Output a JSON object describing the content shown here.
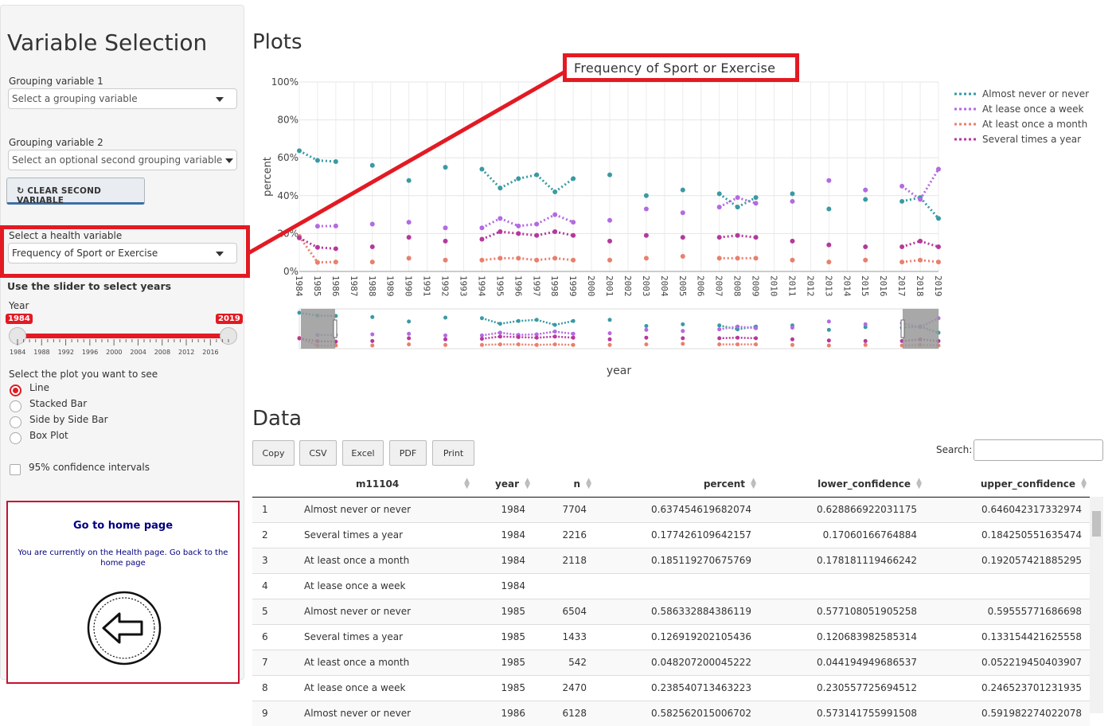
{
  "sidebar": {
    "title": "Variable Selection",
    "group1_label": "Grouping variable 1",
    "group1_placeholder": "Select a grouping variable",
    "group2_label": "Grouping variable 2",
    "group2_placeholder": "Select an optional second grouping variable",
    "clear_button": "CLEAR SECOND VARIABLE",
    "health_label": "Select a health variable",
    "health_value": "Frequency of Sport or Exercise",
    "slider_heading": "Use the slider to select years",
    "slider_label": "Year",
    "slider_min": "1984",
    "slider_max": "2019",
    "slider_ticks": [
      "1984",
      "1988",
      "1992",
      "1996",
      "2000",
      "2004",
      "2008",
      "2012",
      "2016"
    ],
    "plot_type_label": "Select the plot you want to see",
    "plot_types": [
      "Line",
      "Stacked Bar",
      "Side by Side Bar",
      "Box Plot"
    ],
    "plot_type_selected": "Line",
    "ci_label": "95% confidence intervals",
    "home_title": "Go to home page",
    "home_text": "You are currently on the Health page. Go back to the home page"
  },
  "main": {
    "plots_heading": "Plots",
    "data_heading": "Data",
    "buttons": [
      "Copy",
      "CSV",
      "Excel",
      "PDF",
      "Print"
    ],
    "search_label": "Search:"
  },
  "annotation": {
    "callout_text": "Frequency of Sport or Exercise"
  },
  "colors": {
    "accent": "#e31a23",
    "teal": "#3a9aa3",
    "purple": "#b36ae2",
    "salmon": "#e8806e",
    "magenta": "#b5399b"
  },
  "chart_data": {
    "type": "line",
    "xlabel": "year",
    "ylabel": "percent",
    "ylim": [
      0,
      1
    ],
    "yticks": [
      "0%",
      "20%",
      "40%",
      "60%",
      "80%",
      "100%"
    ],
    "x": [
      1984,
      1985,
      1986,
      1987,
      1988,
      1989,
      1990,
      1991,
      1992,
      1993,
      1994,
      1995,
      1996,
      1997,
      1998,
      1999,
      2000,
      2001,
      2002,
      2003,
      2004,
      2005,
      2006,
      2007,
      2008,
      2009,
      2010,
      2011,
      2012,
      2013,
      2014,
      2015,
      2016,
      2017,
      2018,
      2019
    ],
    "legend_position": "top-right",
    "series": [
      {
        "name": "Almost never or never",
        "color": "#3a9aa3",
        "values": [
          0.637,
          0.586,
          0.58,
          null,
          0.56,
          null,
          0.48,
          null,
          0.55,
          null,
          0.54,
          0.44,
          0.49,
          0.51,
          0.42,
          0.49,
          null,
          0.51,
          null,
          0.4,
          null,
          0.43,
          null,
          0.41,
          0.34,
          0.39,
          null,
          0.41,
          null,
          0.33,
          null,
          0.38,
          null,
          0.37,
          0.39,
          0.28
        ]
      },
      {
        "name": "At lease once a week",
        "color": "#b36ae2",
        "values": [
          null,
          0.239,
          0.24,
          null,
          0.25,
          null,
          0.26,
          null,
          0.23,
          null,
          0.23,
          0.28,
          0.24,
          0.25,
          0.3,
          0.26,
          null,
          0.27,
          null,
          0.33,
          null,
          0.31,
          null,
          0.34,
          0.39,
          0.36,
          null,
          0.37,
          null,
          0.48,
          null,
          0.43,
          null,
          0.45,
          0.38,
          0.54
        ]
      },
      {
        "name": "At least once a month",
        "color": "#e8806e",
        "values": [
          0.185,
          0.048,
          0.05,
          null,
          0.05,
          null,
          0.07,
          null,
          0.06,
          null,
          0.06,
          0.07,
          0.07,
          0.06,
          0.07,
          0.06,
          null,
          0.06,
          null,
          0.07,
          null,
          0.08,
          null,
          0.07,
          0.07,
          0.07,
          null,
          0.06,
          null,
          0.05,
          null,
          0.06,
          null,
          0.05,
          0.06,
          0.05
        ]
      },
      {
        "name": "Several times a year",
        "color": "#b5399b",
        "values": [
          0.177,
          0.127,
          0.12,
          null,
          0.13,
          null,
          0.18,
          null,
          0.16,
          null,
          0.17,
          0.21,
          0.2,
          0.19,
          0.21,
          0.19,
          null,
          0.16,
          null,
          0.19,
          null,
          0.18,
          null,
          0.18,
          0.19,
          0.18,
          null,
          0.16,
          null,
          0.14,
          null,
          0.13,
          null,
          0.13,
          0.16,
          0.13
        ]
      }
    ]
  },
  "table": {
    "columns": [
      "",
      "m11104",
      "year",
      "n",
      "percent",
      "lower_confidence",
      "upper_confidence"
    ],
    "rows": [
      [
        "1",
        "Almost never or never",
        "1984",
        "7704",
        "0.637454619682074",
        "0.628866922031175",
        "0.646042317332974"
      ],
      [
        "2",
        "Several times a year",
        "1984",
        "2216",
        "0.177426109642157",
        "0.17060166764884",
        "0.184250551635474"
      ],
      [
        "3",
        "At least once a month",
        "1984",
        "2118",
        "0.185119270675769",
        "0.178181119466242",
        "0.192057421885295"
      ],
      [
        "4",
        "At lease once a week",
        "1984",
        "",
        "",
        "",
        ""
      ],
      [
        "5",
        "Almost never or never",
        "1985",
        "6504",
        "0.586332884386119",
        "0.577108051905258",
        "0.59555771686698"
      ],
      [
        "6",
        "Several times a year",
        "1985",
        "1433",
        "0.126919202105436",
        "0.120683982585314",
        "0.133154421625558"
      ],
      [
        "7",
        "At least once a month",
        "1985",
        "542",
        "0.048207200045222",
        "0.044194949686537",
        "0.052219450403907"
      ],
      [
        "8",
        "At lease once a week",
        "1985",
        "2470",
        "0.238540713463223",
        "0.230557725694512",
        "0.246523701231935"
      ],
      [
        "9",
        "Almost never or never",
        "1986",
        "6128",
        "0.582562015006702",
        "0.573141755991508",
        "0.591982274022078"
      ]
    ]
  }
}
